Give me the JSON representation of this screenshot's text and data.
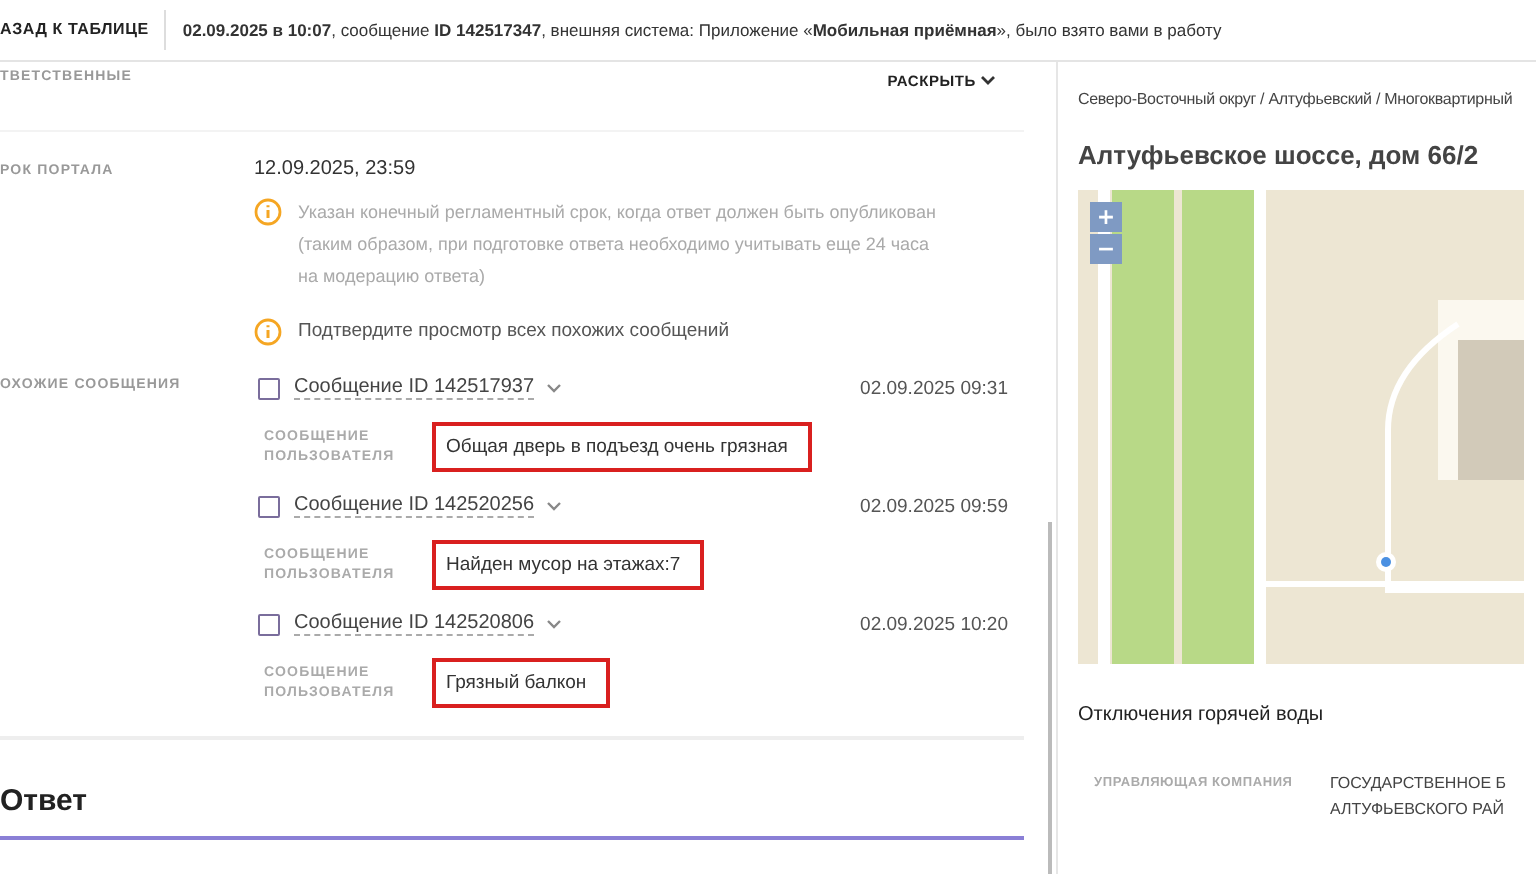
{
  "top_bar": {
    "back_link": "АЗАД К ТАБЛИЦЕ",
    "status": "**02.09.2025 в 10:07**, сообщение **ID 142517347**, внешняя система: Приложение «**Мобильная приёмная**», было взято вами в работу"
  },
  "responsible": {
    "label": "ТВЕТСТВЕННЫЕ",
    "expand_link": "РАСКРЫТЬ"
  },
  "portal_deadline": {
    "label": "РОК ПОРТАЛА",
    "value": "12.09.2025, 23:59",
    "note": "Указан конечный регламентный срок, когда ответ должен быть опубликован (таким образом, при подготовке ответа необходимо учитывать еще 24 часа на модерацию ответа)"
  },
  "confirm_notice": "Подтвердите просмотр всех похожих сообщений",
  "similar": {
    "label": "ОХОЖИЕ СООБЩЕНИЯ",
    "items": [
      {
        "link": "Сообщение ID 142517937",
        "date": "02.09.2025 09:31",
        "checked": false,
        "user_label": "СООБЩЕНИЕ ПОЛЬЗОВАТЕЛЯ",
        "user_message": "Общая дверь в подъезд очень грязная"
      },
      {
        "link": "Сообщение ID 142520256",
        "date": "02.09.2025 09:59",
        "checked": false,
        "user_label": "СООБЩЕНИЕ ПОЛЬЗОВАТЕЛЯ",
        "user_message": "Найден мусор на этажах:7"
      },
      {
        "link": "Сообщение ID 142520806",
        "date": "02.09.2025 10:20",
        "checked": false,
        "user_label": "СООБЩЕНИЕ ПОЛЬЗОВАТЕЛЯ",
        "user_message": "Грязный балкон"
      }
    ]
  },
  "answer": {
    "title": "Ответ"
  },
  "address_panel": {
    "breadcrumb": "Северо-Восточный округ / Алтуфьевский / Многоквартирный",
    "title": "Алтуфьевское шоссе, дом 66/2",
    "map": {
      "zoom_in": "+",
      "zoom_out": "−"
    },
    "hot_water": "Отключения горячей воды",
    "company_label": "УПРАВЛЯЮЩАЯ КОМПАНИЯ",
    "company_value": [
      "ГОСУДАРСТВЕННОЕ Б",
      "АЛТУФЬЕВСКОГО РАЙ"
    ]
  }
}
